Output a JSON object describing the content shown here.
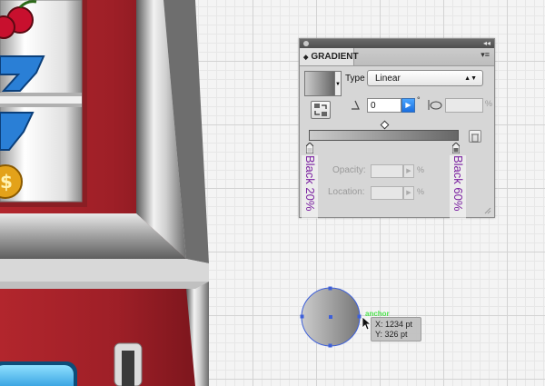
{
  "gradient_panel": {
    "tab_title": "GRADIENT",
    "type_label": "Type",
    "type_value": "Linear",
    "angle_value": "0",
    "degree_symbol": "°",
    "aspect_percent": "%",
    "stop_left_label": "Black 20%",
    "stop_right_label": "Black 60%",
    "opacity_label": "Opacity:",
    "location_label": "Location:",
    "percent_symbol": "%",
    "gradient_start_color": "#cccccc",
    "gradient_end_color": "#666666"
  },
  "canvas": {
    "anchor_hint": "anchor",
    "coord_x": "X: 1234 pt",
    "coord_y": "Y: 326 pt",
    "selection_color": "#3d5fd9"
  },
  "icons": [
    "close-icon",
    "collapse-icon",
    "panel-menu-icon",
    "dropdown-icon",
    "reverse-gradient-icon",
    "angle-icon",
    "aspect-ratio-icon",
    "trash-icon",
    "pointer-cursor-icon"
  ]
}
